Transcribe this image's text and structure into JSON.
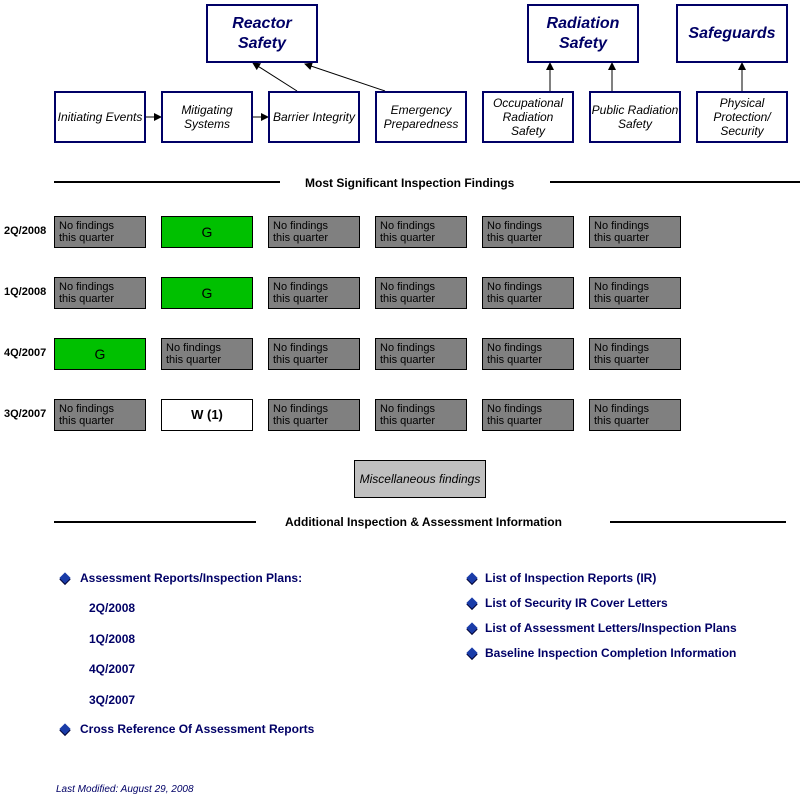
{
  "categories": [
    {
      "id": "reactor-safety",
      "label": "Reactor Safety"
    },
    {
      "id": "radiation-safety",
      "label": "Radiation Safety"
    },
    {
      "id": "safeguards",
      "label": "Safeguards"
    }
  ],
  "cornerstones": [
    {
      "id": "initiating-events",
      "label": "Initiating Events"
    },
    {
      "id": "mitigating-systems",
      "label": "Mitigating Systems"
    },
    {
      "id": "barrier-integrity",
      "label": "Barrier Integrity"
    },
    {
      "id": "emergency-preparedness",
      "label": "Emergency Preparedness"
    },
    {
      "id": "occupational-radiation-safety",
      "label": "Occupational Radiation Safety"
    },
    {
      "id": "public-radiation-safety",
      "label": "Public Radiation Safety"
    },
    {
      "id": "physical-protection-security",
      "label": "Physical Protection/ Security"
    }
  ],
  "findings_section": {
    "title": "Most Significant Inspection Findings",
    "no_findings_line1": "No findings",
    "no_findings_line2": "this quarter",
    "rows": [
      {
        "quarter": "2Q/2008",
        "cells": [
          {
            "type": "none"
          },
          {
            "type": "green",
            "label": "G"
          },
          {
            "type": "none"
          },
          {
            "type": "none"
          },
          {
            "type": "none"
          },
          {
            "type": "none"
          }
        ]
      },
      {
        "quarter": "1Q/2008",
        "cells": [
          {
            "type": "none"
          },
          {
            "type": "green",
            "label": "G"
          },
          {
            "type": "none"
          },
          {
            "type": "none"
          },
          {
            "type": "none"
          },
          {
            "type": "none"
          }
        ]
      },
      {
        "quarter": "4Q/2007",
        "cells": [
          {
            "type": "green",
            "label": "G"
          },
          {
            "type": "none"
          },
          {
            "type": "none"
          },
          {
            "type": "none"
          },
          {
            "type": "none"
          },
          {
            "type": "none"
          }
        ]
      },
      {
        "quarter": "3Q/2007",
        "cells": [
          {
            "type": "none"
          },
          {
            "type": "white",
            "label": "W (1)"
          },
          {
            "type": "none"
          },
          {
            "type": "none"
          },
          {
            "type": "none"
          },
          {
            "type": "none"
          }
        ]
      }
    ],
    "misc_button": "Miscellaneous findings"
  },
  "additional_section": {
    "title": "Additional Inspection & Assessment Information",
    "left_links": {
      "assessment_reports": "Assessment Reports/Inspection Plans:",
      "quarters": [
        "2Q/2008",
        "1Q/2008",
        "4Q/2007",
        "3Q/2007"
      ],
      "cross_reference": "Cross Reference Of Assessment Reports"
    },
    "right_links": [
      "List of Inspection Reports (IR)",
      "List of Security IR Cover Letters",
      "List of Assessment Letters/Inspection Plans",
      "Baseline Inspection Completion Information"
    ]
  },
  "footer": {
    "last_modified": "Last Modified:  August 29, 2008"
  },
  "colors": {
    "navy": "#000066",
    "green_finding": "#00c000",
    "no_finding_gray": "#808080",
    "misc_gray": "#c0c0c0"
  }
}
